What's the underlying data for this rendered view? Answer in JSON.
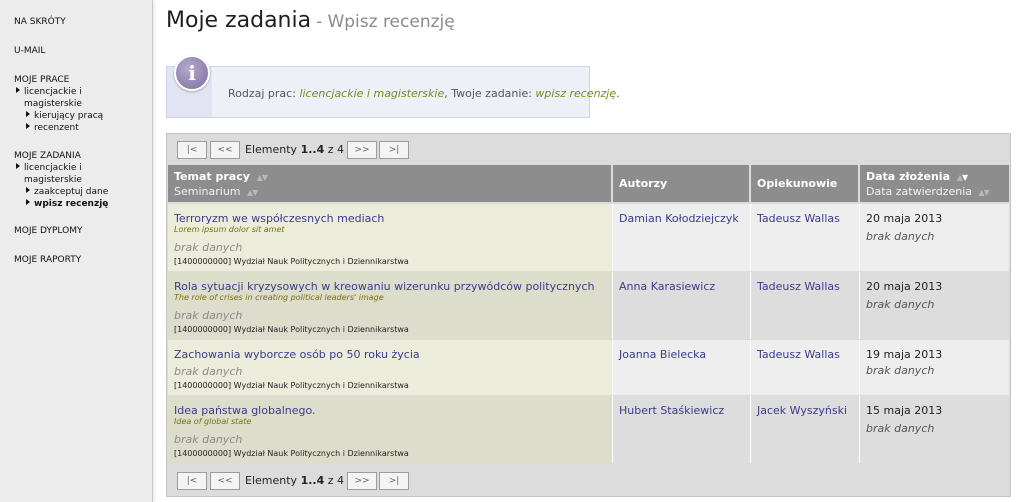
{
  "sidebar": {
    "shortcuts": "NA SKRÓTY",
    "umail": "U-MAIL",
    "moje_prace": {
      "title": "MOJE PRACE",
      "item1_line1": "licencjackie i",
      "item1_line2": "magisterskie",
      "sub1": "kierujący pracą",
      "sub2": "recenzent"
    },
    "moje_zadania": {
      "title": "MOJE ZADANIA",
      "item1_line1": "licencjackie i",
      "item1_line2": "magisterskie",
      "sub1": "zaakceptuj dane",
      "sub2": "wpisz recenzję"
    },
    "dyplomy": "MOJE DYPLOMY",
    "raporty": "MOJE RAPORTY"
  },
  "header": {
    "title": "Moje zadania",
    "separator": "-",
    "subtitle": "Wpisz recenzję"
  },
  "info": {
    "icon": "info-icon",
    "prefix": "Rodzaj prac:",
    "work_type": "licencjackie i magisterskie",
    "middle": ", Twoje zadanie:",
    "task": "wpisz recenzję",
    "suffix": "."
  },
  "pager": {
    "first": "|<",
    "prev": "<<",
    "next": ">>",
    "last": ">|",
    "label_prefix": "Elementy",
    "range": "1..4",
    "of": "z 4"
  },
  "columns": {
    "topic": "Temat pracy",
    "seminar": "Seminarium",
    "authors": "Autorzy",
    "supervisors": "Opiekunowie",
    "date_created": "Data złożenia",
    "date_approved": "Data zatwierdzenia"
  },
  "rows": [
    {
      "title": "Terroryzm we współczesnych mediach",
      "title_en": "Lorem ipsum dolor sit amet",
      "seminar": "brak danych",
      "dept": "[1400000000] Wydział Nauk Politycznych i Dziennikarstwa",
      "author": "Damian Kołodziejczyk",
      "supervisor": "Tadeusz Wallas",
      "date": "20 maja 2013",
      "date2": "brak danych"
    },
    {
      "title": "Rola sytuacji kryzysowych w kreowaniu wizerunku przywódców politycznych",
      "title_en": "The role of crises in creating political leaders' image",
      "seminar": "brak danych",
      "dept": "[1400000000] Wydział Nauk Politycznych i Dziennikarstwa",
      "author": "Anna Karasiewicz",
      "supervisor": "Tadeusz Wallas",
      "date": "20 maja 2013",
      "date2": "brak danych"
    },
    {
      "title": "Zachowania wyborcze osób po 50 roku życia",
      "title_en": "",
      "seminar": "brak danych",
      "dept": "[1400000000] Wydział Nauk Politycznych i Dziennikarstwa",
      "author": "Joanna Bielecka",
      "supervisor": "Tadeusz Wallas",
      "date": "19 maja 2013",
      "date2": "brak danych"
    },
    {
      "title": "Idea państwa globalnego.",
      "title_en": "Idea of global state",
      "seminar": "brak danych",
      "dept": "[1400000000] Wydział Nauk Politycznych i Dziennikarstwa",
      "author": "Hubert Staśkiewicz",
      "supervisor": "Jacek Wyszyński",
      "date": "15 maja 2013",
      "date2": "brak danych"
    }
  ],
  "colors": {
    "row_odd_topic": "#ebecd9",
    "row_odd_other": "#eeeeee",
    "row_even_topic": "#dcddca",
    "row_even_other": "#dddddd",
    "header_bg": "#8d8d8d",
    "link": "#3b3b8a",
    "accent_olive": "#7b8a14"
  }
}
